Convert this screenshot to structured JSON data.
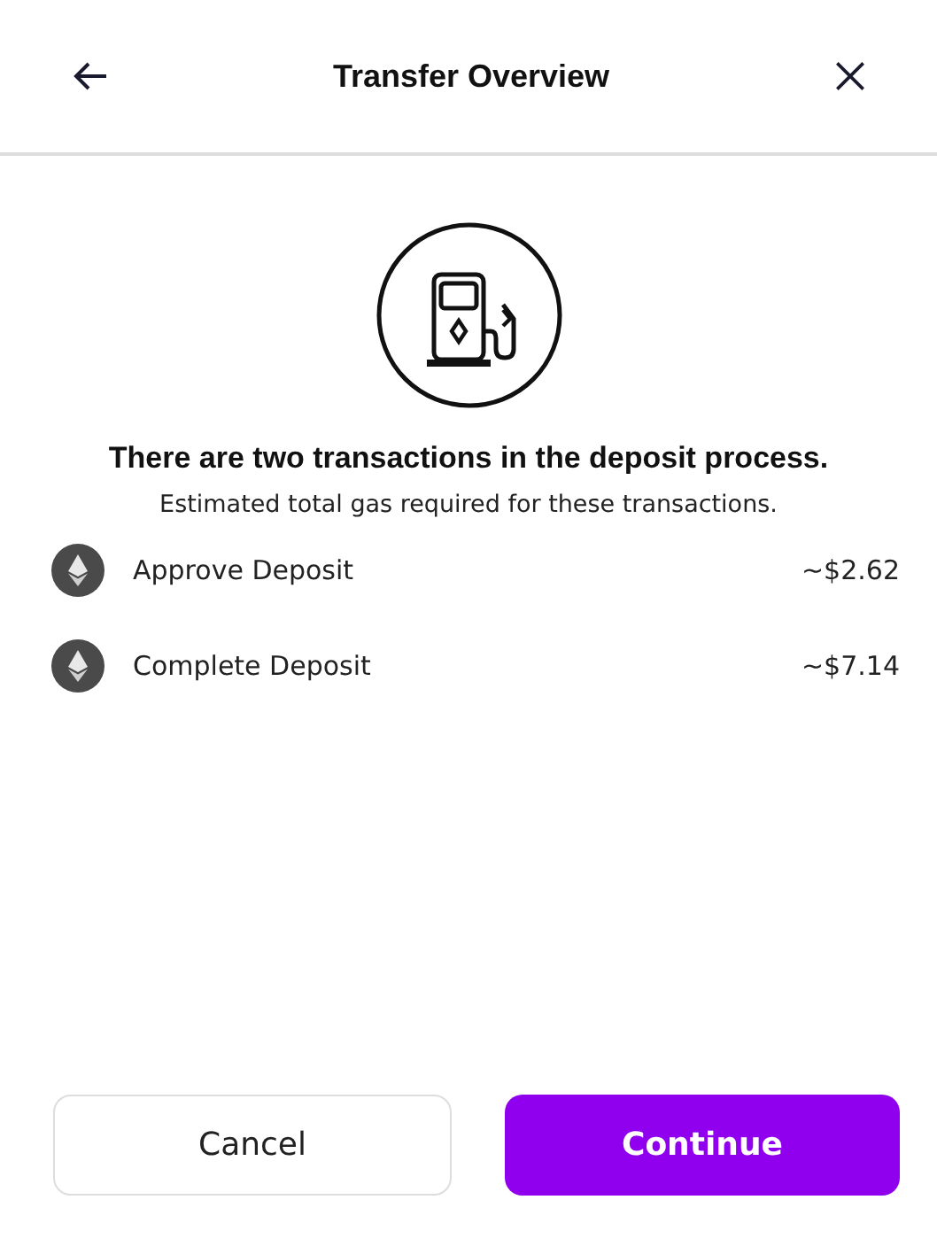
{
  "header": {
    "title": "Transfer Overview"
  },
  "heading": "There are two transactions in the deposit process.",
  "subtitle": "Estimated total gas required for these transactions.",
  "transactions": [
    {
      "label": "Approve Deposit",
      "amount": "~$2.62"
    },
    {
      "label": "Complete Deposit",
      "amount": "~$7.14"
    }
  ],
  "buttons": [
    {
      "label": "Cancel",
      "kind": "secondary"
    },
    {
      "label": "Continue",
      "kind": "primary"
    }
  ]
}
